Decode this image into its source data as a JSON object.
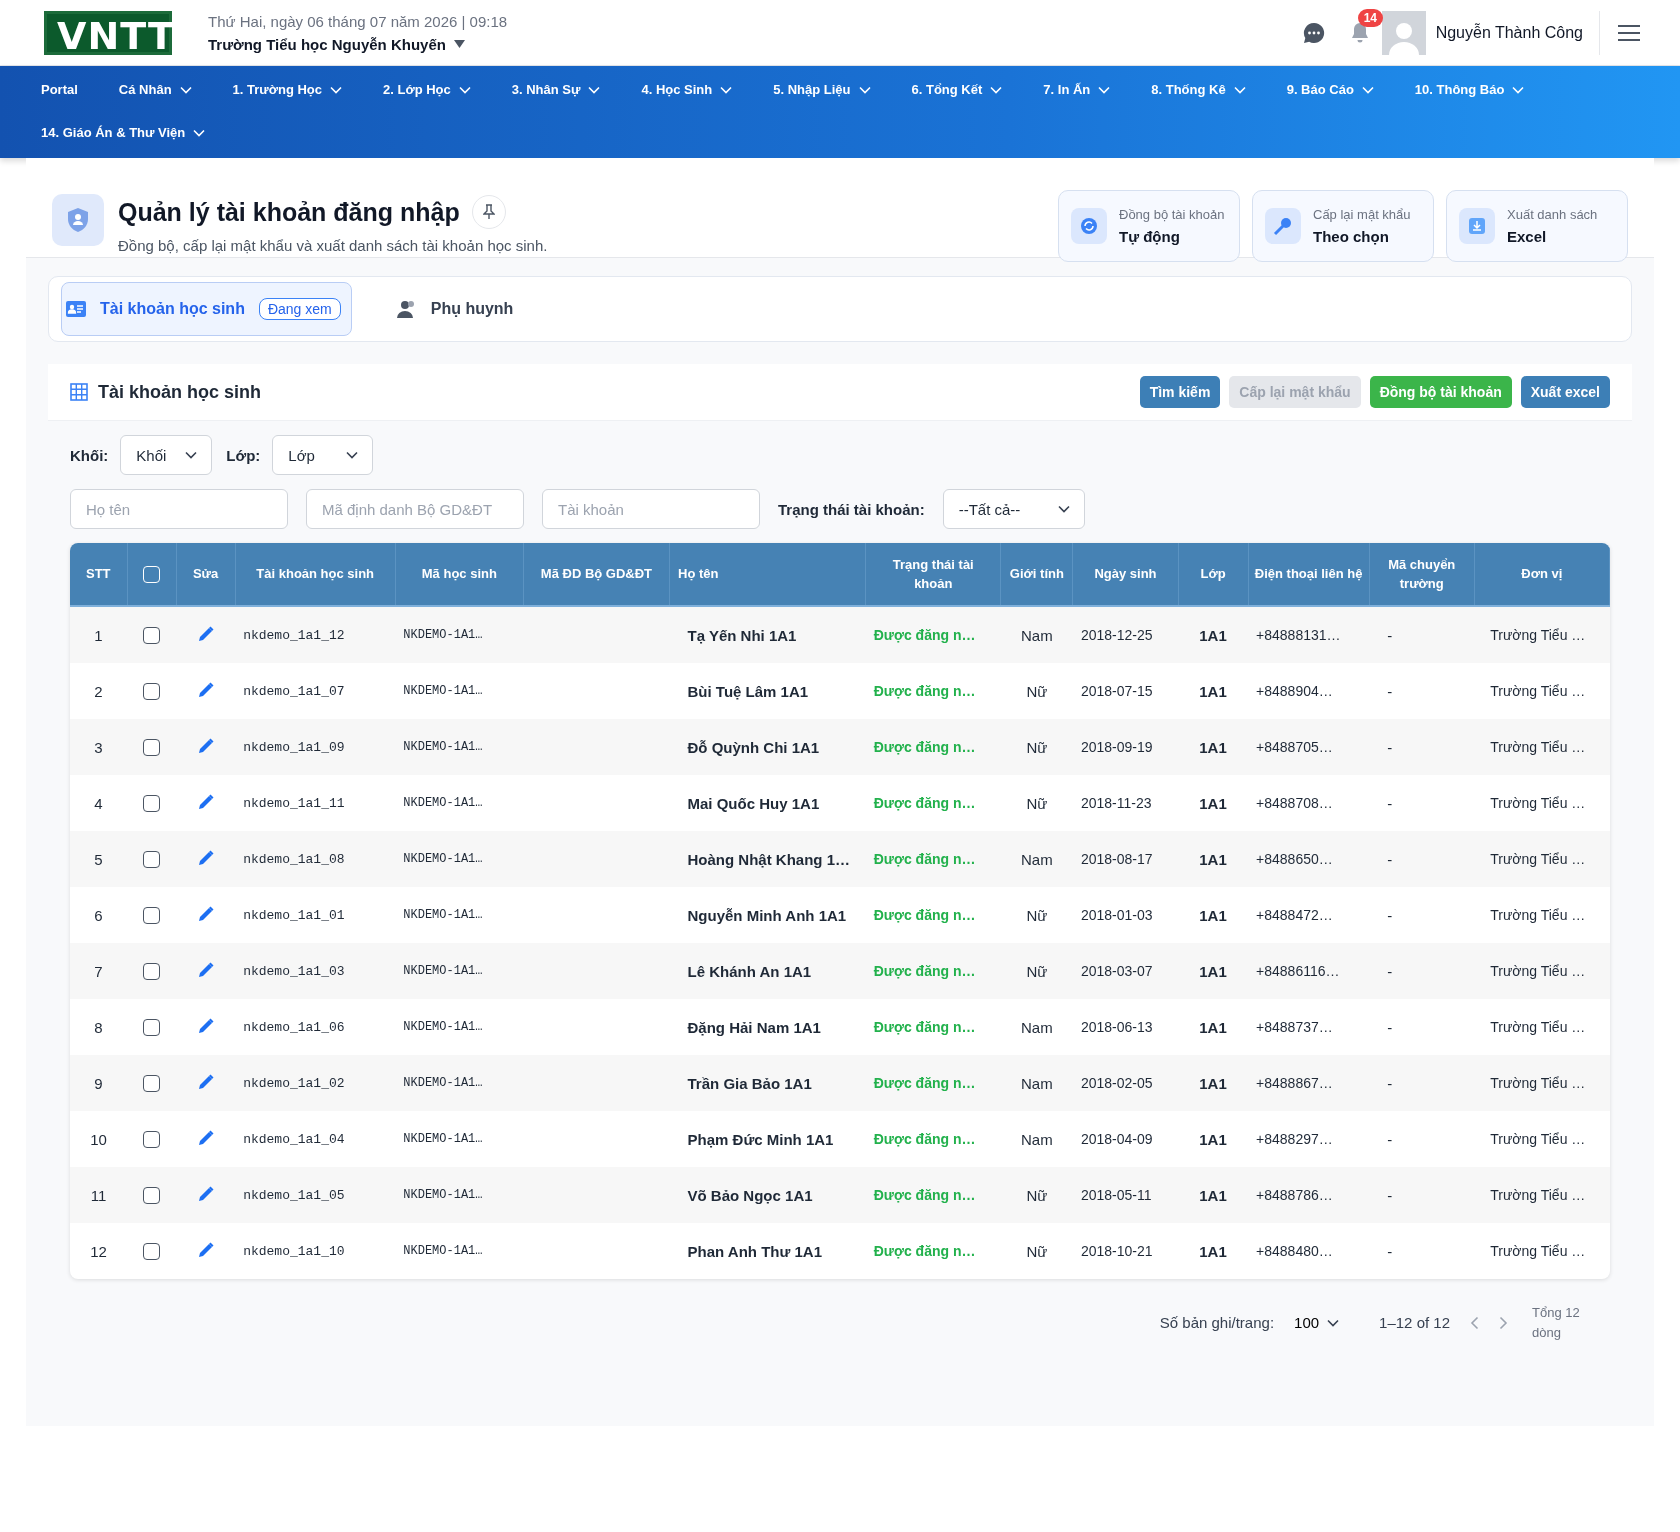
{
  "header": {
    "logo": "VNTT",
    "date": "Thứ Hai, ngày 06 tháng 07 năm 2026 | 09:18",
    "school": "Trường Tiểu học Nguyễn Khuyến",
    "notifications": "14",
    "user": "Nguyễn Thành Công"
  },
  "nav": {
    "rows": [
      [
        {
          "label": "Portal",
          "dropdown": false
        },
        {
          "label": "Cá Nhân",
          "dropdown": true
        },
        {
          "label": "1. Trường Học",
          "dropdown": true
        },
        {
          "label": "2. Lớp Học",
          "dropdown": true
        },
        {
          "label": "3. Nhân Sự",
          "dropdown": true
        },
        {
          "label": "4. Học Sinh",
          "dropdown": true
        },
        {
          "label": "5. Nhập Liệu",
          "dropdown": true
        },
        {
          "label": "6. Tổng Kết",
          "dropdown": true
        },
        {
          "label": "7. In Ấn",
          "dropdown": true
        },
        {
          "label": "8. Thống Kê",
          "dropdown": true
        },
        {
          "label": "9. Báo Cáo",
          "dropdown": true
        },
        {
          "label": "10. Thông Báo",
          "dropdown": true
        }
      ],
      [
        {
          "label": "14. Giáo Án & Thư Viện",
          "dropdown": true
        }
      ]
    ]
  },
  "page": {
    "title": "Quản lý tài khoản đăng nhập",
    "subtitle": "Đồng bộ, cấp lại mật khẩu và xuất danh sách tài khoản học sinh.",
    "actions": [
      {
        "label": "Đồng bộ tài khoản",
        "value": "Tự động"
      },
      {
        "label": "Cấp lại mật khẩu",
        "value": "Theo chọn"
      },
      {
        "label": "Xuất danh sách",
        "value": "Excel"
      }
    ]
  },
  "tabs": [
    {
      "label": "Tài khoản học sinh",
      "badge": "Đang xem",
      "selected": true
    },
    {
      "label": "Phụ huynh",
      "selected": false
    }
  ],
  "panel": {
    "title": "Tài khoản học sinh",
    "buttons": [
      {
        "label": "Tìm kiếm",
        "kind": "primary",
        "disabled": false
      },
      {
        "label": "Cấp lại mật khẩu",
        "kind": "primary",
        "disabled": true
      },
      {
        "label": "Đồng bộ tài khoản",
        "kind": "success",
        "disabled": false
      },
      {
        "label": "Xuất excel",
        "kind": "primary",
        "disabled": false
      }
    ],
    "filters": {
      "grade_label": "Khối:",
      "grade_value": "Khối",
      "class_label": "Lớp:",
      "class_value": "Lớp",
      "name_placeholder": "Họ tên",
      "id_placeholder": "Mã định danh Bộ GD&ĐT",
      "account_placeholder": "Tài khoản",
      "status_label": "Trạng thái tài khoản:",
      "status_value": "--Tất cả--"
    },
    "table": {
      "columns": [
        "STT",
        "Sửa",
        "Tài khoản học sinh",
        "Mã học sinh",
        "Mã ĐD Bộ GD&ĐT",
        "Họ tên",
        "Trạng thái tài khoản",
        "Giới tính",
        "Ngày sinh",
        "Lớp",
        "Điện thoại liên hệ",
        "Mã chuyển trường",
        "Đơn vị"
      ],
      "select_all": {
        "checked": false
      },
      "rows": [
        {
          "stt": "1",
          "checked": false,
          "account": "nkdemo_1a1_12",
          "student_code": "NKDEMO-1A1…",
          "name": "Tạ Yến Nhi 1A1",
          "status": "Được đăng n…",
          "gender": "Nam",
          "dob": "2018-12-25",
          "class": "1A1",
          "phone": "+84888131…",
          "transfer": "-",
          "unit": "Trường Tiểu …"
        },
        {
          "stt": "2",
          "checked": false,
          "account": "nkdemo_1a1_07",
          "student_code": "NKDEMO-1A1…",
          "name": "Bùi Tuệ Lâm 1A1",
          "status": "Được đăng n…",
          "gender": "Nữ",
          "dob": "2018-07-15",
          "class": "1A1",
          "phone": "+8488904…",
          "transfer": "-",
          "unit": "Trường Tiểu …"
        },
        {
          "stt": "3",
          "checked": false,
          "account": "nkdemo_1a1_09",
          "student_code": "NKDEMO-1A1…",
          "name": "Đỗ Quỳnh Chi 1A1",
          "status": "Được đăng n…",
          "gender": "Nữ",
          "dob": "2018-09-19",
          "class": "1A1",
          "phone": "+8488705…",
          "transfer": "-",
          "unit": "Trường Tiểu …"
        },
        {
          "stt": "4",
          "checked": false,
          "account": "nkdemo_1a1_11",
          "student_code": "NKDEMO-1A1…",
          "name": "Mai Quốc Huy 1A1",
          "status": "Được đăng n…",
          "gender": "Nữ",
          "dob": "2018-11-23",
          "class": "1A1",
          "phone": "+8488708…",
          "transfer": "-",
          "unit": "Trường Tiểu …"
        },
        {
          "stt": "5",
          "checked": false,
          "account": "nkdemo_1a1_08",
          "student_code": "NKDEMO-1A1…",
          "name": "Hoàng Nhật Khang 1…",
          "status": "Được đăng n…",
          "gender": "Nam",
          "dob": "2018-08-17",
          "class": "1A1",
          "phone": "+8488650…",
          "transfer": "-",
          "unit": "Trường Tiểu …"
        },
        {
          "stt": "6",
          "checked": false,
          "account": "nkdemo_1a1_01",
          "student_code": "NKDEMO-1A1…",
          "name": "Nguyễn Minh Anh 1A1",
          "status": "Được đăng n…",
          "gender": "Nữ",
          "dob": "2018-01-03",
          "class": "1A1",
          "phone": "+8488472…",
          "transfer": "-",
          "unit": "Trường Tiểu …"
        },
        {
          "stt": "7",
          "checked": false,
          "account": "nkdemo_1a1_03",
          "student_code": "NKDEMO-1A1…",
          "name": "Lê Khánh An 1A1",
          "status": "Được đăng n…",
          "gender": "Nữ",
          "dob": "2018-03-07",
          "class": "1A1",
          "phone": "+84886116…",
          "transfer": "-",
          "unit": "Trường Tiểu …"
        },
        {
          "stt": "8",
          "checked": false,
          "account": "nkdemo_1a1_06",
          "student_code": "NKDEMO-1A1…",
          "name": "Đặng Hải Nam 1A1",
          "status": "Được đăng n…",
          "gender": "Nam",
          "dob": "2018-06-13",
          "class": "1A1",
          "phone": "+8488737…",
          "transfer": "-",
          "unit": "Trường Tiểu …"
        },
        {
          "stt": "9",
          "checked": false,
          "account": "nkdemo_1a1_02",
          "student_code": "NKDEMO-1A1…",
          "name": "Trần Gia Bảo 1A1",
          "status": "Được đăng n…",
          "gender": "Nam",
          "dob": "2018-02-05",
          "class": "1A1",
          "phone": "+8488867…",
          "transfer": "-",
          "unit": "Trường Tiểu …"
        },
        {
          "stt": "10",
          "checked": false,
          "account": "nkdemo_1a1_04",
          "student_code": "NKDEMO-1A1…",
          "name": "Phạm Đức Minh 1A1",
          "status": "Được đăng n…",
          "gender": "Nam",
          "dob": "2018-04-09",
          "class": "1A1",
          "phone": "+8488297…",
          "transfer": "-",
          "unit": "Trường Tiểu …"
        },
        {
          "stt": "11",
          "checked": false,
          "account": "nkdemo_1a1_05",
          "student_code": "NKDEMO-1A1…",
          "name": "Võ Bảo Ngọc 1A1",
          "status": "Được đăng n…",
          "gender": "Nữ",
          "dob": "2018-05-11",
          "class": "1A1",
          "phone": "+8488786…",
          "transfer": "-",
          "unit": "Trường Tiểu …"
        },
        {
          "stt": "12",
          "checked": false,
          "account": "nkdemo_1a1_10",
          "student_code": "NKDEMO-1A1…",
          "name": "Phan Anh Thư 1A1",
          "status": "Được đăng n…",
          "gender": "Nữ",
          "dob": "2018-10-21",
          "class": "1A1",
          "phone": "+8488480…",
          "transfer": "-",
          "unit": "Trường Tiểu …"
        }
      ]
    },
    "pager": {
      "label": "Số bản ghi/trang:",
      "page_size": "100",
      "range": "1–12 of 12",
      "total": "Tổng 12 dòng"
    }
  }
}
